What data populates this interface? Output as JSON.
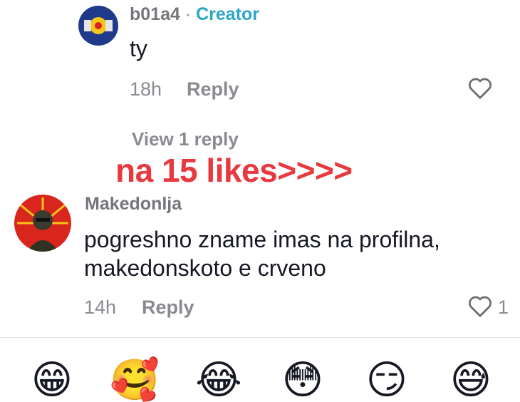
{
  "comments": [
    {
      "username": "b01a4",
      "separator": "·",
      "badge": "Creator",
      "text": "ty",
      "time": "18h",
      "reply_label": "Reply",
      "like_count": ""
    },
    {
      "username": "Makedonlja",
      "text_line1": "pogreshno zname imas na profilna,",
      "text_line2": "makedonskoto e crveno",
      "time": "14h",
      "reply_label": "Reply",
      "like_count": "1"
    }
  ],
  "view_replies_label": "View 1 reply",
  "overlay_text": "na 15 likes>>>>",
  "colors": {
    "creator_badge": "#2aa6c6",
    "overlay": "#e8393f",
    "muted": "#8a8b91"
  },
  "emoji_bar": [
    "😁",
    "🥰",
    "😂",
    "😳",
    "😏",
    "😅"
  ]
}
